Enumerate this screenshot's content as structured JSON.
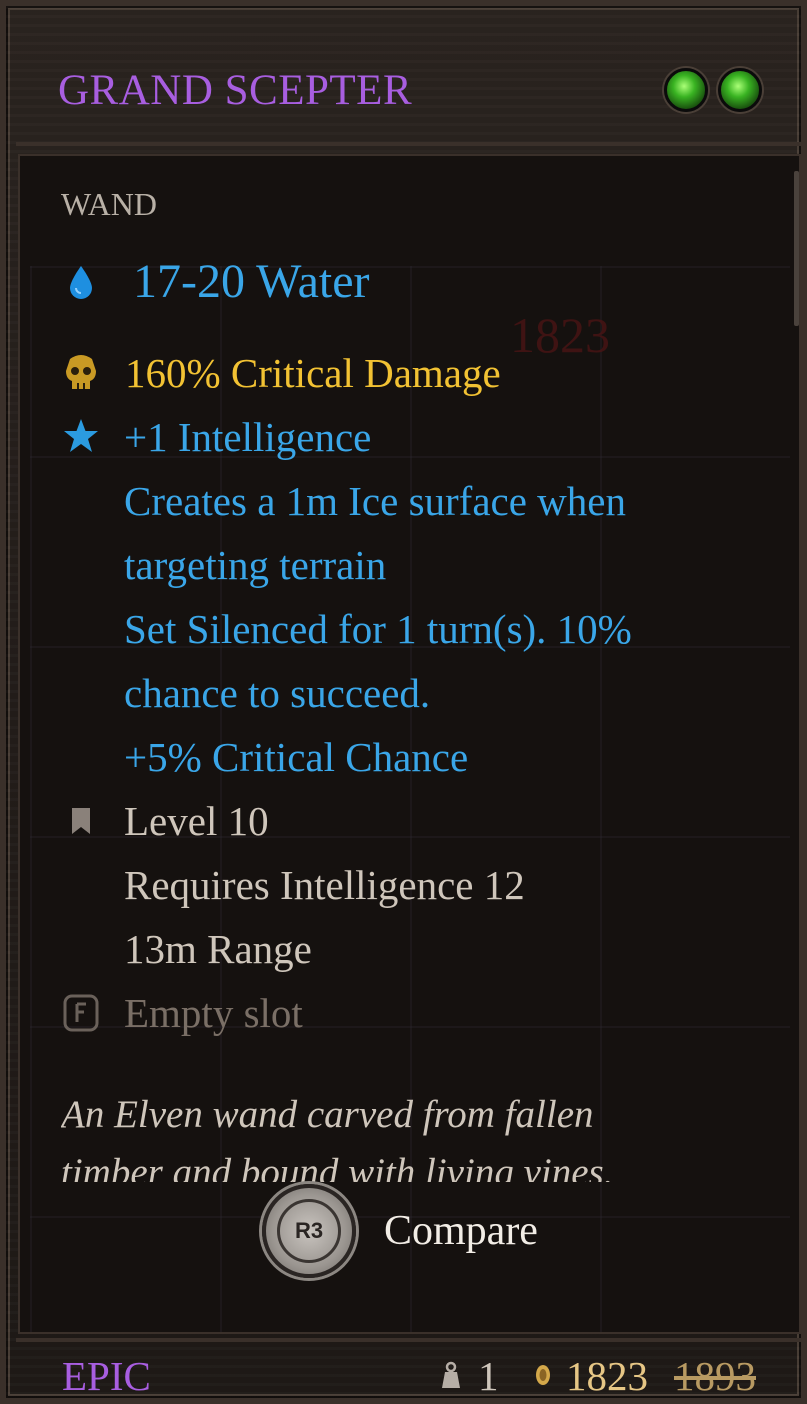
{
  "item": {
    "name": "GRAND SCEPTER",
    "type": "WAND",
    "ghost_price": "1823",
    "damage": "17-20 Water",
    "critical_damage": "160% Critical Damage",
    "bonus_lines": [
      "+1 Intelligence",
      "Creates a 1m Ice surface when",
      "targeting terrain",
      "Set Silenced for 1 turn(s). 10%",
      "chance to succeed.",
      "+5% Critical Chance"
    ],
    "level": "Level 10",
    "requirements": "Requires Intelligence 12",
    "range": "13m Range",
    "empty_slot": "Empty slot",
    "description_lines": [
      "An Elven wand carved from fallen",
      "timber and bound with living vines."
    ],
    "rarity": "EPIC",
    "weight": "1",
    "price": "1823",
    "original_price": "1893",
    "sockets": 2
  },
  "compare": {
    "button_glyph": "R3",
    "label": "Compare"
  },
  "colors": {
    "rarity_epic": "#a85ee0",
    "water": "#3aa6e8",
    "crit": "#f2c233",
    "gem": "#39b322"
  },
  "icons": [
    "water-drop-icon",
    "skull-icon",
    "star-icon",
    "bookmark-icon",
    "rune-slot-icon",
    "weight-icon",
    "coin-icon"
  ]
}
